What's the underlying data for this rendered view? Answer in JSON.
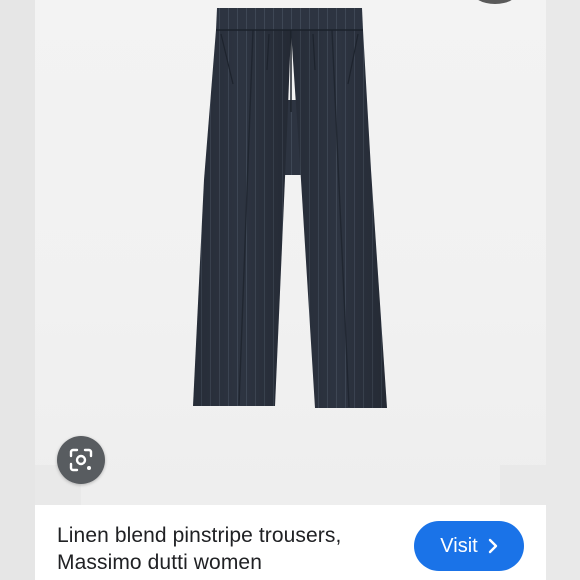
{
  "result": {
    "title_line1": "Linen blend pinstripe trousers,",
    "title_line2": "Massimo dutti women",
    "visit_label": "Visit"
  },
  "icons": {
    "lens": "lens-camera-icon",
    "visit_arrow": "chevron-right-icon"
  },
  "colors": {
    "primary_button": "#1a73e8",
    "trousers": "#2d3441",
    "background": "#f2f2f2"
  }
}
